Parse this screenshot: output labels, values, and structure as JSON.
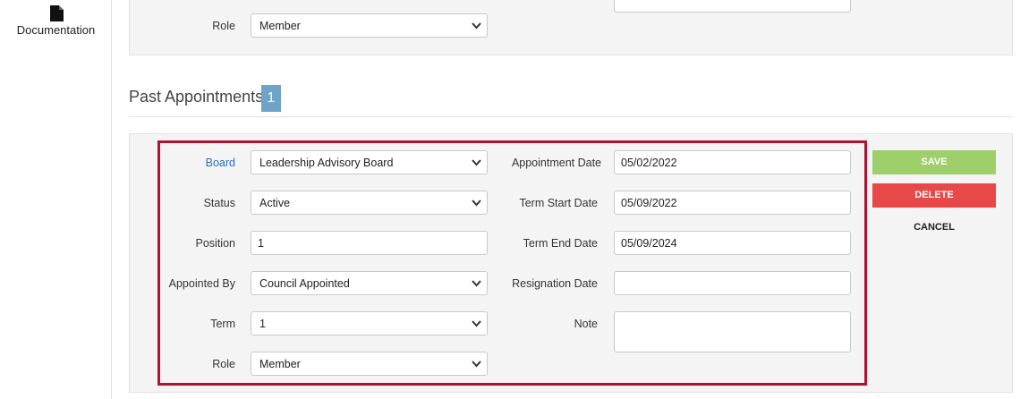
{
  "sidebar": {
    "documentation_label": "Documentation"
  },
  "top_form": {
    "role_label": "Role",
    "role_value": "Member"
  },
  "section": {
    "title": "Past Appointments",
    "count": "1"
  },
  "form": {
    "board_label": "Board",
    "board_value": "Leadership Advisory Board",
    "status_label": "Status",
    "status_value": "Active",
    "position_label": "Position",
    "position_value": "1",
    "appointed_by_label": "Appointed By",
    "appointed_by_value": "Council Appointed",
    "term_label": "Term",
    "term_value": "1",
    "role_label": "Role",
    "role_value": "Member",
    "appointment_date_label": "Appointment Date",
    "appointment_date_value": "05/02/2022",
    "term_start_label": "Term Start Date",
    "term_start_value": "05/09/2022",
    "term_end_label": "Term End Date",
    "term_end_value": "05/09/2024",
    "resignation_label": "Resignation Date",
    "resignation_value": "",
    "note_label": "Note",
    "note_value": ""
  },
  "actions": {
    "save": "SAVE",
    "delete": "DELETE",
    "cancel": "CANCEL"
  },
  "colors": {
    "save": "#9fcf6a",
    "delete": "#e84848",
    "highlight": "#b0132f",
    "badge": "#6ea4c8",
    "link": "#2a6ebb"
  },
  "icons": {
    "documentation": "document-icon",
    "select": "chevron-down-icon"
  }
}
